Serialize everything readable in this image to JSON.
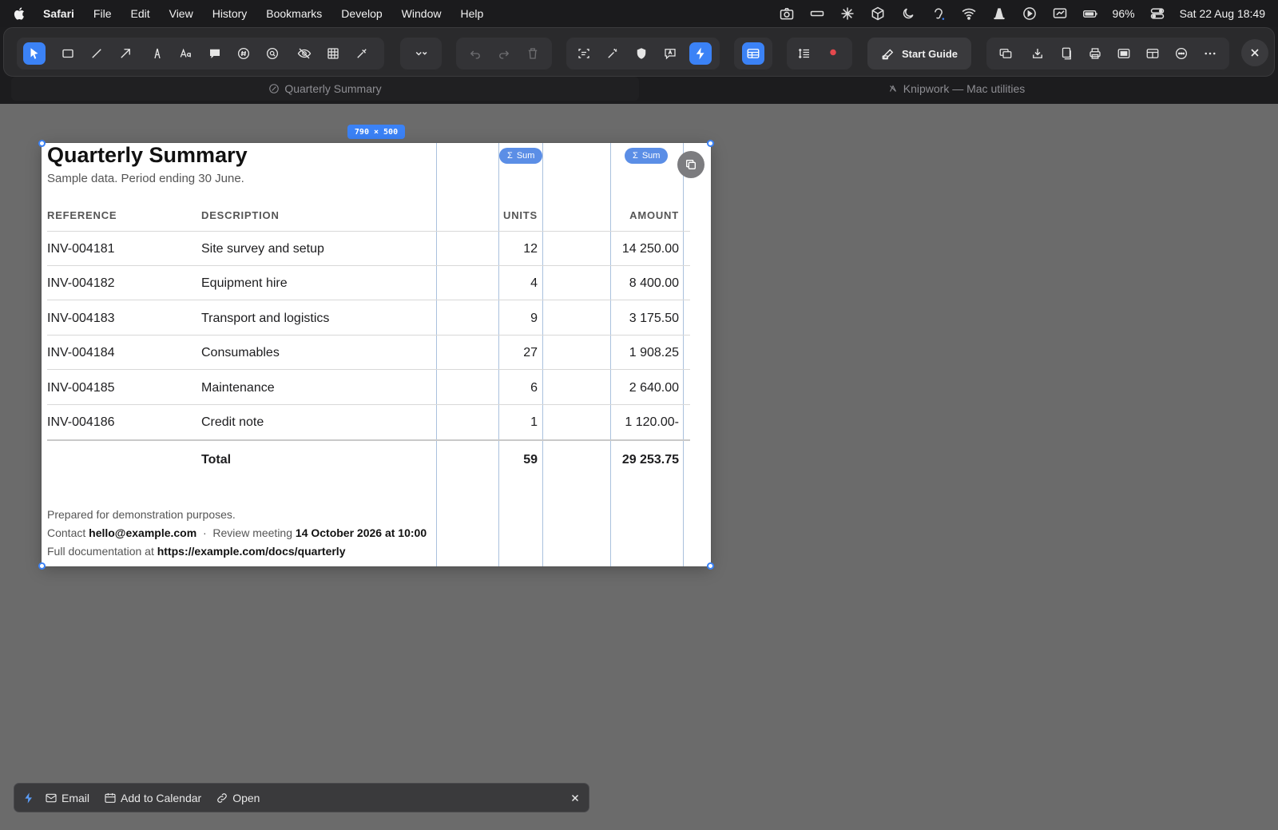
{
  "menubar": {
    "app": "Safari",
    "items": [
      "File",
      "Edit",
      "View",
      "History",
      "Bookmarks",
      "Develop",
      "Window",
      "Help"
    ],
    "battery": "96%",
    "datetime": "Sat 22 Aug  18:49"
  },
  "toolbar": {
    "start_guide": "Start Guide"
  },
  "tabs": [
    {
      "title": "Quarterly Summary"
    },
    {
      "title": "Knipwork — Mac utilities"
    }
  ],
  "selection": {
    "size_label": "790 × 500"
  },
  "document": {
    "title": "Quarterly Summary",
    "subtitle": "Sample data. Period ending 30 June.",
    "sum_label": "Sum",
    "columns": [
      "REFERENCE",
      "DESCRIPTION",
      "UNITS",
      "AMOUNT"
    ],
    "rows": [
      {
        "ref": "INV-004181",
        "desc": "Site survey and setup",
        "units": "12",
        "amount": "14 250.00"
      },
      {
        "ref": "INV-004182",
        "desc": "Equipment hire",
        "units": "4",
        "amount": "8 400.00"
      },
      {
        "ref": "INV-004183",
        "desc": "Transport and logistics",
        "units": "9",
        "amount": "3 175.50"
      },
      {
        "ref": "INV-004184",
        "desc": "Consumables",
        "units": "27",
        "amount": "1 908.25"
      },
      {
        "ref": "INV-004185",
        "desc": "Maintenance",
        "units": "6",
        "amount": "2 640.00"
      },
      {
        "ref": "INV-004186",
        "desc": "Credit note",
        "units": "1",
        "amount": "1 120.00-"
      }
    ],
    "total": {
      "label": "Total",
      "units": "59",
      "amount": "29 253.75"
    },
    "footer": {
      "line1": "Prepared for demonstration purposes.",
      "contact_label": "Contact",
      "contact_email": "hello@example.com",
      "separator": "·",
      "meeting_label": "Review meeting",
      "meeting_date": "14 October 2026 at 10:00",
      "docs_label": "Full documentation at",
      "docs_url": "https://example.com/docs/quarterly"
    }
  },
  "actionbar": {
    "email": "Email",
    "calendar": "Add to Calendar",
    "open": "Open"
  },
  "colors": {
    "accent": "#3b82f6",
    "sum_pill": "#5b8ee6",
    "record": "#e5484d"
  }
}
